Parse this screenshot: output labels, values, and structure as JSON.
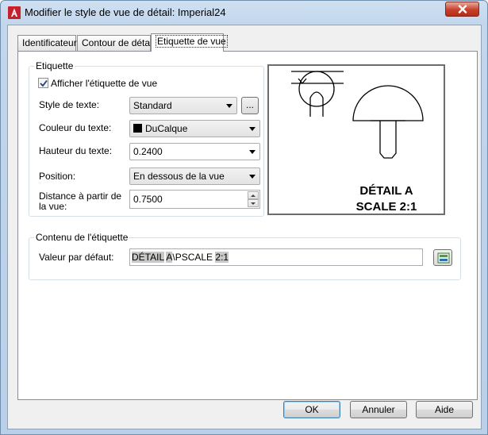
{
  "window": {
    "title": "Modifier le style de vue de détail: Imperial24",
    "close_glyph": "×"
  },
  "tabs": [
    {
      "label": "Identificateur"
    },
    {
      "label": "Contour de détail"
    },
    {
      "label": "Etiquette de vue"
    }
  ],
  "etiquette_group": {
    "title": "Etiquette",
    "show_label_checkbox": {
      "label": "Afficher l'étiquette de vue",
      "checked": true
    },
    "text_style": {
      "label": "Style de texte:",
      "value": "Standard",
      "browse_label": "..."
    },
    "text_color": {
      "label": "Couleur du texte:",
      "value": "DuCalque",
      "swatch_color": "#000000"
    },
    "text_height": {
      "label": "Hauteur du texte:",
      "value": "0.2400"
    },
    "position": {
      "label": "Position:",
      "value": "En dessous de la vue"
    },
    "distance": {
      "label_line1": "Distance à partir de",
      "label_line2": "la vue:",
      "value": "0.7500"
    }
  },
  "preview": {
    "line1": "DÉTAIL A",
    "line2": "SCALE 2:1"
  },
  "content_group": {
    "title": "Contenu de l'étiquette",
    "default_value_label": "Valeur par défaut:",
    "field_tokens": {
      "token1": "DÉTAIL",
      "token2": "A",
      "literal": "\\PSCALE",
      "token3": "2:1"
    },
    "insert_field_icon": "insert-field-icon"
  },
  "buttons": {
    "ok": "OK",
    "cancel": "Annuler",
    "help": "Aide"
  }
}
